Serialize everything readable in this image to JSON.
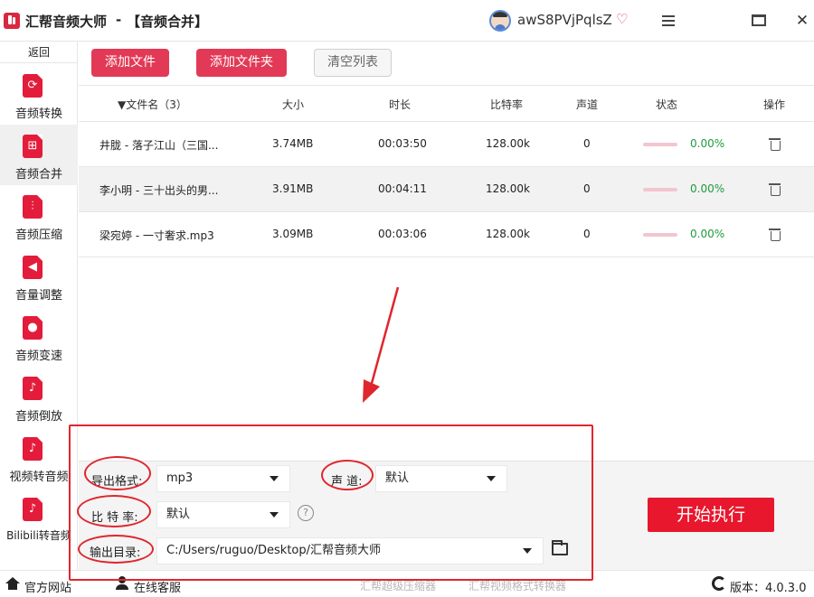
{
  "titlebar": {
    "app_title": "汇帮音频大师",
    "separator": "-",
    "page_title": "【音频合并】",
    "username": "awS8PVjPqlsZ",
    "vip_glyph": "♡",
    "close_glyph": "✕"
  },
  "sidebar": {
    "back_label": "返回",
    "items": [
      {
        "label": "音频转换",
        "glyph": "⟳",
        "icon": "audio-convert-icon"
      },
      {
        "label": "音频合并",
        "glyph": "⊞",
        "icon": "audio-merge-icon"
      },
      {
        "label": "音频压缩",
        "glyph": "⫶",
        "icon": "audio-compress-icon"
      },
      {
        "label": "音量调整",
        "glyph": "◀",
        "icon": "volume-icon"
      },
      {
        "label": "音频变速",
        "glyph": "●",
        "icon": "microphone-icon"
      },
      {
        "label": "音频倒放",
        "glyph": "♪",
        "icon": "music-note-icon"
      },
      {
        "label": "视频转音频",
        "glyph": "♪",
        "icon": "video-to-audio-icon"
      },
      {
        "label": "Bilibili转音频",
        "glyph": "♪",
        "icon": "bilibili-icon"
      }
    ],
    "active_index": 1
  },
  "toolbar": {
    "add_file": "添加文件",
    "add_folder": "添加文件夹",
    "clear_list": "清空列表"
  },
  "table": {
    "headers": {
      "filename": "▼文件名（3）",
      "size": "大小",
      "duration": "时长",
      "bitrate": "比特率",
      "channels": "声道",
      "status": "状态",
      "actions": "操作"
    },
    "rows": [
      {
        "name": "井胧 - 落子江山（三国...",
        "size": "3.74MB",
        "duration": "00:03:50",
        "bitrate": "128.00k",
        "channels": "0",
        "progress": 0,
        "status": "0.00%"
      },
      {
        "name": "李小明 - 三十出头的男...",
        "size": "3.91MB",
        "duration": "00:04:11",
        "bitrate": "128.00k",
        "channels": "0",
        "progress": 0,
        "status": "0.00%"
      },
      {
        "name": "梁宛婷 - 一寸奢求.mp3",
        "size": "3.09MB",
        "duration": "00:03:06",
        "bitrate": "128.00k",
        "channels": "0",
        "progress": 0,
        "status": "0.00%"
      }
    ]
  },
  "settings": {
    "format_label": "导出格式:",
    "format_value": "mp3",
    "channel_label": "声 道:",
    "channel_value": "默认",
    "bitrate_label": "比 特 率:",
    "bitrate_value": "默认",
    "help_glyph": "?",
    "output_label": "输出目录:",
    "output_value": "C:/Users/ruguo/Desktop/汇帮音频大师",
    "start_button": "开始执行"
  },
  "statusbar": {
    "website": "官方网站",
    "support": "在线客服",
    "promo1": "汇帮超级压缩器",
    "promo2": "汇帮视频格式转换器",
    "version": "版本：4.0.3.0"
  },
  "colors": {
    "brand_red": "#e23a56",
    "start_red": "#e8172d",
    "annotation_red": "#e0262d",
    "status_green": "#1e9b3c"
  }
}
